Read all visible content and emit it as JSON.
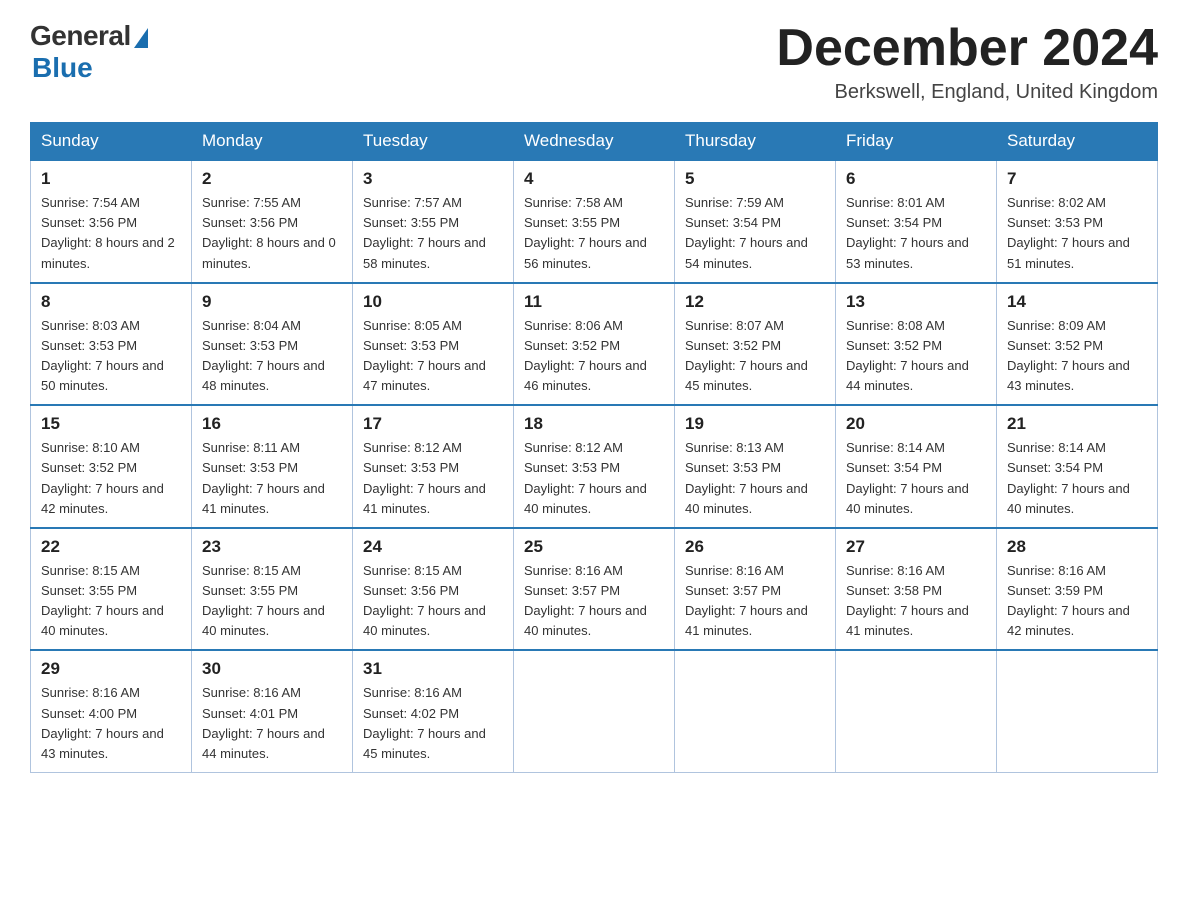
{
  "header": {
    "logo_general": "General",
    "logo_blue": "Blue",
    "month_title": "December 2024",
    "location": "Berkswell, England, United Kingdom"
  },
  "days_of_week": [
    "Sunday",
    "Monday",
    "Tuesday",
    "Wednesday",
    "Thursday",
    "Friday",
    "Saturday"
  ],
  "weeks": [
    [
      {
        "day": "1",
        "sunrise": "7:54 AM",
        "sunset": "3:56 PM",
        "daylight": "8 hours and 2 minutes."
      },
      {
        "day": "2",
        "sunrise": "7:55 AM",
        "sunset": "3:56 PM",
        "daylight": "8 hours and 0 minutes."
      },
      {
        "day": "3",
        "sunrise": "7:57 AM",
        "sunset": "3:55 PM",
        "daylight": "7 hours and 58 minutes."
      },
      {
        "day": "4",
        "sunrise": "7:58 AM",
        "sunset": "3:55 PM",
        "daylight": "7 hours and 56 minutes."
      },
      {
        "day": "5",
        "sunrise": "7:59 AM",
        "sunset": "3:54 PM",
        "daylight": "7 hours and 54 minutes."
      },
      {
        "day": "6",
        "sunrise": "8:01 AM",
        "sunset": "3:54 PM",
        "daylight": "7 hours and 53 minutes."
      },
      {
        "day": "7",
        "sunrise": "8:02 AM",
        "sunset": "3:53 PM",
        "daylight": "7 hours and 51 minutes."
      }
    ],
    [
      {
        "day": "8",
        "sunrise": "8:03 AM",
        "sunset": "3:53 PM",
        "daylight": "7 hours and 50 minutes."
      },
      {
        "day": "9",
        "sunrise": "8:04 AM",
        "sunset": "3:53 PM",
        "daylight": "7 hours and 48 minutes."
      },
      {
        "day": "10",
        "sunrise": "8:05 AM",
        "sunset": "3:53 PM",
        "daylight": "7 hours and 47 minutes."
      },
      {
        "day": "11",
        "sunrise": "8:06 AM",
        "sunset": "3:52 PM",
        "daylight": "7 hours and 46 minutes."
      },
      {
        "day": "12",
        "sunrise": "8:07 AM",
        "sunset": "3:52 PM",
        "daylight": "7 hours and 45 minutes."
      },
      {
        "day": "13",
        "sunrise": "8:08 AM",
        "sunset": "3:52 PM",
        "daylight": "7 hours and 44 minutes."
      },
      {
        "day": "14",
        "sunrise": "8:09 AM",
        "sunset": "3:52 PM",
        "daylight": "7 hours and 43 minutes."
      }
    ],
    [
      {
        "day": "15",
        "sunrise": "8:10 AM",
        "sunset": "3:52 PM",
        "daylight": "7 hours and 42 minutes."
      },
      {
        "day": "16",
        "sunrise": "8:11 AM",
        "sunset": "3:53 PM",
        "daylight": "7 hours and 41 minutes."
      },
      {
        "day": "17",
        "sunrise": "8:12 AM",
        "sunset": "3:53 PM",
        "daylight": "7 hours and 41 minutes."
      },
      {
        "day": "18",
        "sunrise": "8:12 AM",
        "sunset": "3:53 PM",
        "daylight": "7 hours and 40 minutes."
      },
      {
        "day": "19",
        "sunrise": "8:13 AM",
        "sunset": "3:53 PM",
        "daylight": "7 hours and 40 minutes."
      },
      {
        "day": "20",
        "sunrise": "8:14 AM",
        "sunset": "3:54 PM",
        "daylight": "7 hours and 40 minutes."
      },
      {
        "day": "21",
        "sunrise": "8:14 AM",
        "sunset": "3:54 PM",
        "daylight": "7 hours and 40 minutes."
      }
    ],
    [
      {
        "day": "22",
        "sunrise": "8:15 AM",
        "sunset": "3:55 PM",
        "daylight": "7 hours and 40 minutes."
      },
      {
        "day": "23",
        "sunrise": "8:15 AM",
        "sunset": "3:55 PM",
        "daylight": "7 hours and 40 minutes."
      },
      {
        "day": "24",
        "sunrise": "8:15 AM",
        "sunset": "3:56 PM",
        "daylight": "7 hours and 40 minutes."
      },
      {
        "day": "25",
        "sunrise": "8:16 AM",
        "sunset": "3:57 PM",
        "daylight": "7 hours and 40 minutes."
      },
      {
        "day": "26",
        "sunrise": "8:16 AM",
        "sunset": "3:57 PM",
        "daylight": "7 hours and 41 minutes."
      },
      {
        "day": "27",
        "sunrise": "8:16 AM",
        "sunset": "3:58 PM",
        "daylight": "7 hours and 41 minutes."
      },
      {
        "day": "28",
        "sunrise": "8:16 AM",
        "sunset": "3:59 PM",
        "daylight": "7 hours and 42 minutes."
      }
    ],
    [
      {
        "day": "29",
        "sunrise": "8:16 AM",
        "sunset": "4:00 PM",
        "daylight": "7 hours and 43 minutes."
      },
      {
        "day": "30",
        "sunrise": "8:16 AM",
        "sunset": "4:01 PM",
        "daylight": "7 hours and 44 minutes."
      },
      {
        "day": "31",
        "sunrise": "8:16 AM",
        "sunset": "4:02 PM",
        "daylight": "7 hours and 45 minutes."
      },
      null,
      null,
      null,
      null
    ]
  ]
}
